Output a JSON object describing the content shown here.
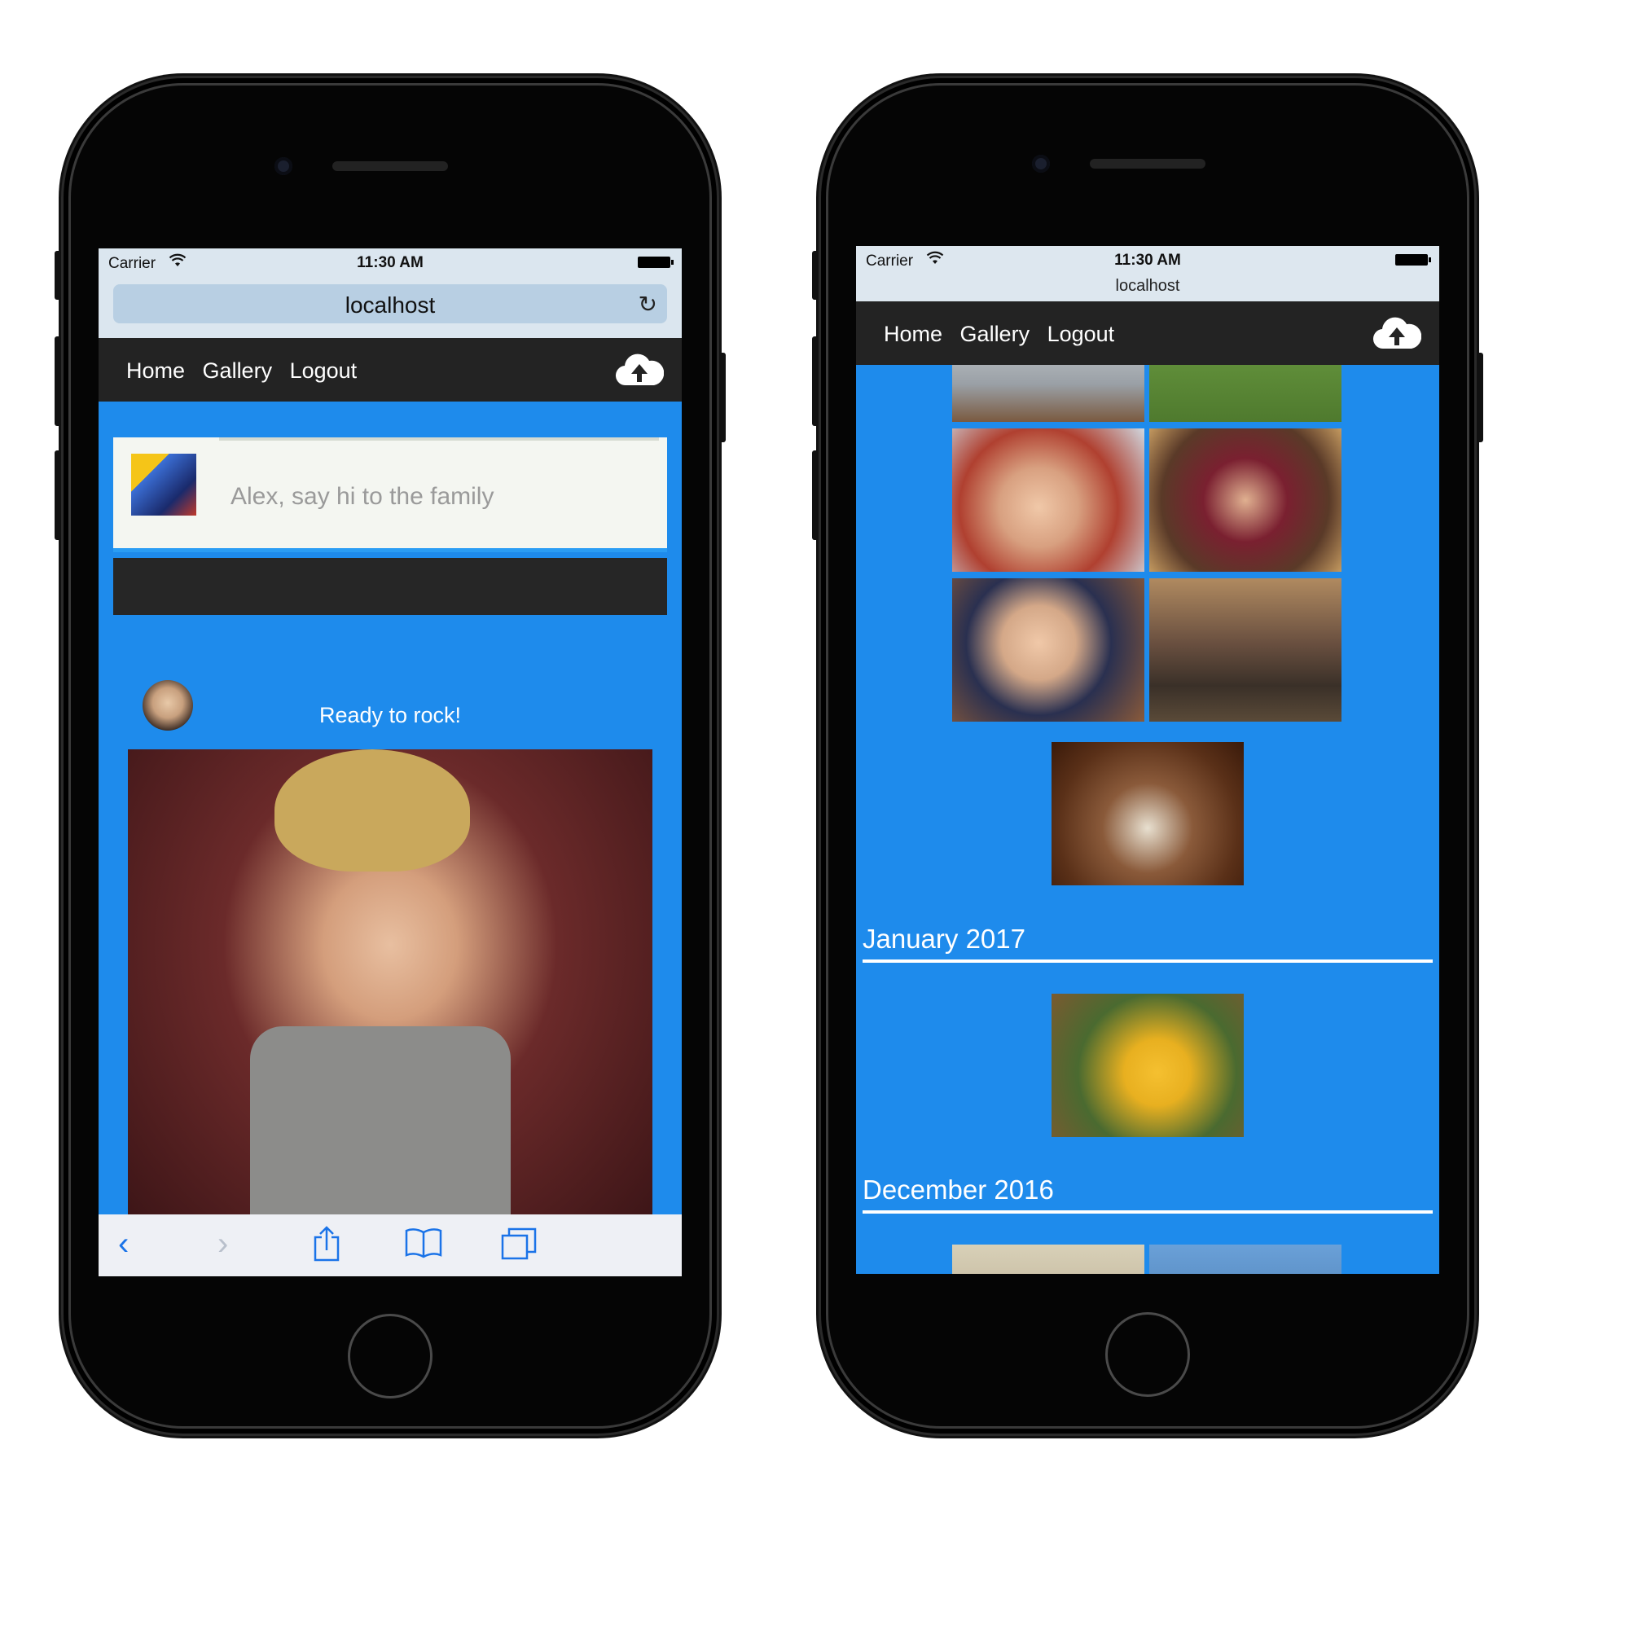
{
  "left_phone": {
    "status": {
      "carrier": "Carrier",
      "time": "11:30 AM"
    },
    "url": "localhost",
    "nav": {
      "home": "Home",
      "gallery": "Gallery",
      "logout": "Logout"
    },
    "composer_placeholder": "Alex, say hi to the family",
    "post": {
      "caption": "Ready to rock!"
    }
  },
  "right_phone": {
    "status": {
      "carrier": "Carrier",
      "time": "11:30 AM"
    },
    "url": "localhost",
    "nav": {
      "home": "Home",
      "gallery": "Gallery",
      "logout": "Logout"
    },
    "months": [
      "January 2017",
      "December 2016"
    ]
  },
  "icons": {
    "upload": "cloud-upload-icon",
    "wifi": "wifi-icon",
    "reload": "reload-icon",
    "back": "back-arrow-icon",
    "forward": "forward-arrow-icon",
    "share": "share-icon",
    "bookmarks": "bookmarks-icon",
    "tabs": "tabs-icon"
  },
  "colors": {
    "page_bg": "#1e8bec",
    "nav_bg": "#232323",
    "accent": "#1a73e8"
  }
}
